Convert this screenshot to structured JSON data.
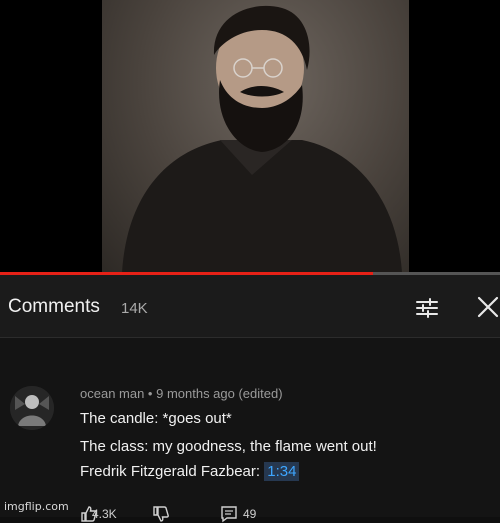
{
  "video": {
    "progress_fraction": 0.745
  },
  "comments_header": {
    "title": "Comments",
    "count": "14K",
    "sort_icon": "sort-icon",
    "close_icon": "close-icon"
  },
  "comment": {
    "author": "ocean man",
    "meta": "ocean man • 9 months ago (edited)",
    "line1": "The candle: *goes out*",
    "line2": "The class: my goodness, the flame went out!",
    "line3_prefix": "Fredrik Fitzgerald Fazbear: ",
    "timestamp": "1:34",
    "likes": "4.3K",
    "replies": "49"
  },
  "watermark": "imgflip.com",
  "colors": {
    "background": "#0f0f0f",
    "header_bg": "#1b1b1b",
    "progress": "#e62117",
    "link": "#3ea6ff"
  }
}
